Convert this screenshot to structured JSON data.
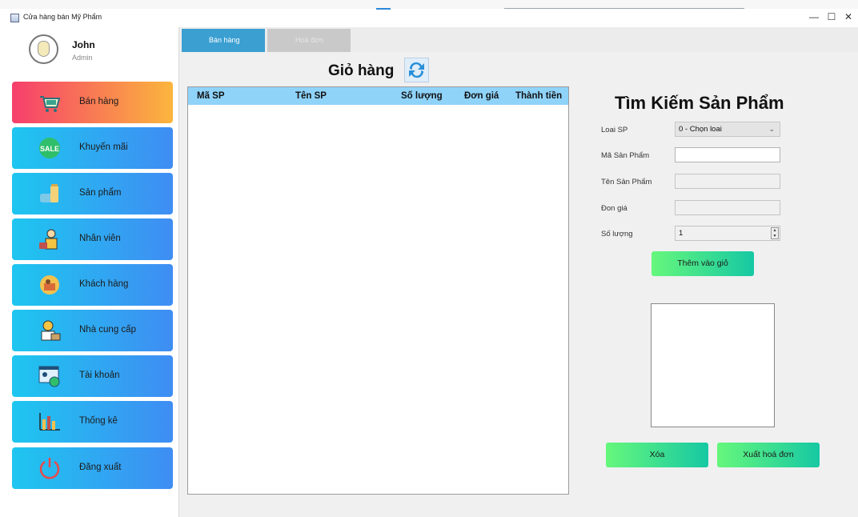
{
  "window": {
    "title": "Cửa hàng bán Mỹ Phẩm",
    "minimize": "—",
    "maximize": "☐",
    "close": "✕"
  },
  "user": {
    "name": "John",
    "role": "Admin"
  },
  "sidebar": {
    "items": [
      {
        "label": "Bán hàng",
        "icon": "shopping-cart-icon",
        "active": true
      },
      {
        "label": "Khuyến mãi",
        "icon": "sale-badge-icon"
      },
      {
        "label": "Sản phẩm",
        "icon": "cosmetics-icon"
      },
      {
        "label": "Nhân viên",
        "icon": "employee-icon"
      },
      {
        "label": "Khách hàng",
        "icon": "customer-icon"
      },
      {
        "label": "Nhà cung cấp",
        "icon": "supplier-icon"
      },
      {
        "label": "Tài khoản",
        "icon": "account-settings-icon"
      },
      {
        "label": "Thống kê",
        "icon": "bar-chart-icon"
      },
      {
        "label": "Đăng xuất",
        "icon": "power-icon"
      }
    ]
  },
  "tabs": [
    {
      "label": "Bán hàng",
      "active": true
    },
    {
      "label": "Hoá đơn",
      "active": false
    }
  ],
  "cart": {
    "title": "Giỏ hàng",
    "columns": [
      "Mã SP",
      "Tên SP",
      "Số lượng",
      "Đơn giá",
      "Thành tiền"
    ],
    "rows": []
  },
  "search": {
    "title": "Tìm Kiếm Sản Phẩm",
    "fields": {
      "category_label": "Loai SP",
      "category_value": "0 - Chọn loai",
      "code_label": "Mã Sản Phẩm",
      "code_value": "",
      "name_label": "Tên Sản Phẩm",
      "name_value": "",
      "price_label": "Đon giá",
      "price_value": "",
      "qty_label": "Số lượng",
      "qty_value": "1"
    },
    "add_button": "Thêm vào giỏ"
  },
  "actions": {
    "delete": "Xóa",
    "export": "Xuất hoá đơn"
  },
  "colors": {
    "active_nav": [
      "#f63e6c",
      "#fbb63d"
    ],
    "nav": [
      "#1ec6f0",
      "#3f8df3"
    ],
    "green_button": [
      "#66f77c",
      "#16c8a3"
    ],
    "table_header": "#8fd3f9",
    "tab_active": "#3b9fd2"
  }
}
